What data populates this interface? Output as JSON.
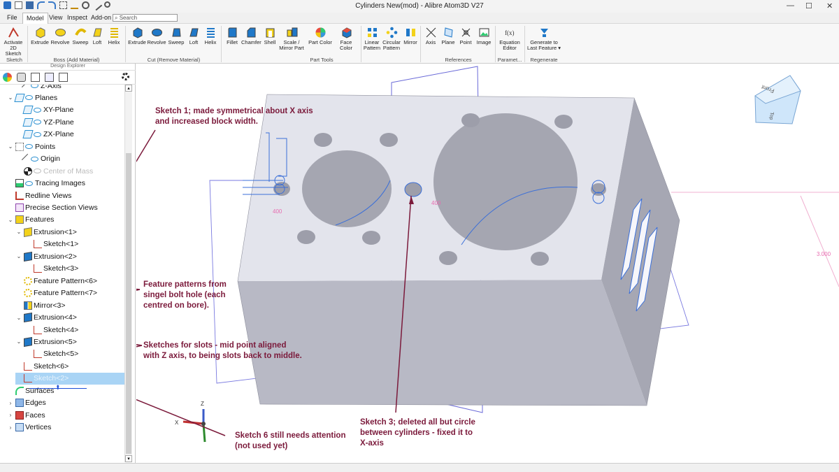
{
  "window": {
    "title": "Cylinders New(mod) - Alibre Atom3D V27"
  },
  "menu": {
    "tabs": [
      "File",
      "Model",
      "View",
      "Inspect",
      "Add-on"
    ],
    "active": "Model",
    "search_placeholder": "Search"
  },
  "ribbon": {
    "activate": "Activate 2D Sketch",
    "boss": [
      "Extrude",
      "Revolve",
      "Sweep",
      "Loft",
      "Helix"
    ],
    "cut": [
      "Extrude",
      "Revolve",
      "Sweep",
      "Loft",
      "Helix"
    ],
    "tools": [
      "Fillet",
      "Chamfer",
      "Shell",
      "Scale / Mirror Part",
      "Part Color",
      "Face Color"
    ],
    "pattern": [
      "Linear Pattern",
      "Circular Pattern",
      "Mirror"
    ],
    "refs": [
      "Axis",
      "Plane",
      "Point",
      "Image"
    ],
    "eq": "Equation Editor",
    "regen": "Generate to Last Feature ▾",
    "groups": [
      "Sketch",
      "Boss (Add Material)",
      "Cut (Remove Material)",
      "Part Tools",
      "References",
      "Paramet...",
      "Regenerate"
    ]
  },
  "explorer": {
    "title": "Design Explorer",
    "tree": [
      {
        "label": "Z-Axis",
        "greyed": false
      },
      {
        "label": "Planes",
        "greyed": false
      },
      {
        "label": "XY-Plane",
        "greyed": false
      },
      {
        "label": "YZ-Plane",
        "greyed": false
      },
      {
        "label": "ZX-Plane",
        "greyed": false
      },
      {
        "label": "Points",
        "greyed": false
      },
      {
        "label": "Origin",
        "greyed": false
      },
      {
        "label": "Center of Mass",
        "greyed": true
      },
      {
        "label": "Tracing Images",
        "greyed": false
      },
      {
        "label": "Redline Views",
        "greyed": false
      },
      {
        "label": "Precise Section Views",
        "greyed": false
      },
      {
        "label": "Features",
        "greyed": false
      },
      {
        "label": "Extrusion<1>",
        "greyed": false
      },
      {
        "label": "Sketch<1>",
        "greyed": false
      },
      {
        "label": "Extrusion<2>",
        "greyed": false
      },
      {
        "label": "Sketch<3>",
        "greyed": false
      },
      {
        "label": "Feature Pattern<6>",
        "greyed": false
      },
      {
        "label": "Feature Pattern<7>",
        "greyed": false
      },
      {
        "label": "Mirror<3>",
        "greyed": false
      },
      {
        "label": "Extrusion<4>",
        "greyed": false
      },
      {
        "label": "Sketch<4>",
        "greyed": false
      },
      {
        "label": "Extrusion<5>",
        "greyed": false
      },
      {
        "label": "Sketch<5>",
        "greyed": false
      },
      {
        "label": "Sketch<6>",
        "greyed": false
      },
      {
        "label": "Sketch<2>",
        "greyed": true
      },
      {
        "label": "Surfaces",
        "greyed": false
      },
      {
        "label": "Edges",
        "greyed": false
      },
      {
        "label": "Faces",
        "greyed": false
      },
      {
        "label": "Vertices",
        "greyed": false
      }
    ]
  },
  "viewport": {
    "dims": [
      "400",
      "400",
      "3.000"
    ],
    "viewcube": {
      "front": "Front",
      "side": "Top"
    },
    "triad": {
      "z": "Z",
      "x": "X"
    }
  },
  "annotations": {
    "sketch1": [
      "Sketch 1; made symmetrical about X axis",
      "and increased block width."
    ],
    "pattern": [
      "Feature patterns from",
      "singel bolt hole (each",
      "centred on bore)."
    ],
    "slots": [
      "Sketches for slots - mid point aligned",
      "with Z axis, to being slots back to middle."
    ],
    "sketch6": [
      "Sketch 6 still needs attention",
      "(not used yet)"
    ],
    "sketch3": [
      "Sketch 3; deleted all but circle",
      "between cylinders - fixed it to",
      "X-axis"
    ]
  },
  "colors": {
    "annotation": "#7b1a3b",
    "sketch_line": "#3b6fd8",
    "part_top": "#e2e3ec",
    "part_front": "#b7b8c4"
  }
}
